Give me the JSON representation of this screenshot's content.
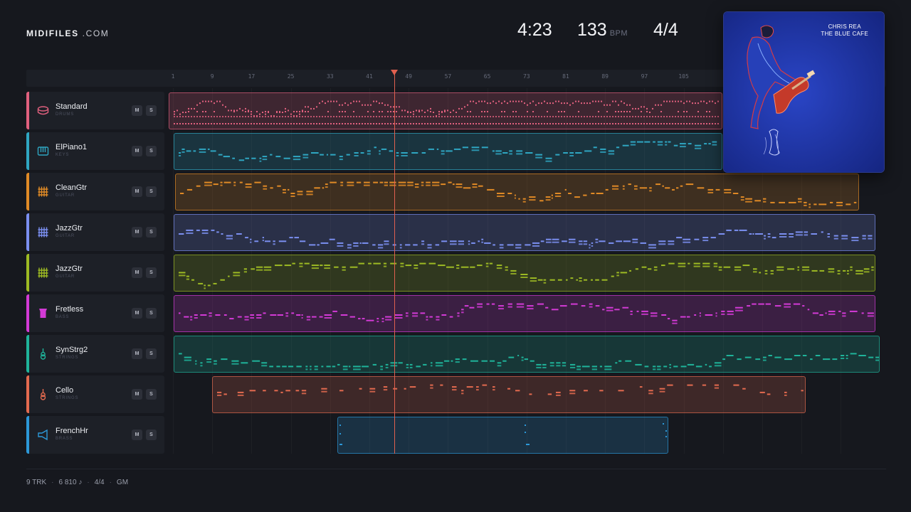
{
  "brand": {
    "bold": "MIDIFILES",
    "light": ".COM"
  },
  "stats": {
    "duration": "4:23",
    "tempo": "133",
    "tempo_unit": "BPM",
    "time_signature": "4/4"
  },
  "ruler": {
    "bars": [
      "1",
      "9",
      "17",
      "25",
      "33",
      "41",
      "49",
      "57",
      "65",
      "73",
      "81",
      "89",
      "97",
      "105"
    ]
  },
  "playhead": {
    "bar": 46
  },
  "album": {
    "line1": "CHRIS REA",
    "line2": "THE BLUE CAFE"
  },
  "tracks": [
    {
      "name": "Standard",
      "category": "DRUMS",
      "icon": "drum-icon",
      "color": "#e0607e",
      "mute": "M",
      "solo": "S"
    },
    {
      "name": "ElPiano1",
      "category": "KEYS",
      "icon": "piano-icon",
      "color": "#2fa6c2",
      "mute": "M",
      "solo": "S"
    },
    {
      "name": "CleanGtr",
      "category": "GUITAR",
      "icon": "guitar-grid-icon",
      "color": "#e08a26",
      "mute": "M",
      "solo": "S"
    },
    {
      "name": "JazzGtr",
      "category": "GUITAR",
      "icon": "guitar-grid-icon",
      "color": "#7b8ff0",
      "mute": "M",
      "solo": "S"
    },
    {
      "name": "JazzGtr",
      "category": "GUITAR",
      "icon": "guitar-grid-icon",
      "color": "#9dba23",
      "mute": "M",
      "solo": "S"
    },
    {
      "name": "Fretless",
      "category": "BASS",
      "icon": "bass-icon",
      "color": "#d33ad6",
      "mute": "M",
      "solo": "S"
    },
    {
      "name": "SynStrg2",
      "category": "STRINGS",
      "icon": "violin-icon",
      "color": "#1fb39a",
      "mute": "M",
      "solo": "S"
    },
    {
      "name": "Cello",
      "category": "STRINGS",
      "icon": "violin-icon",
      "color": "#e36a4f",
      "mute": "M",
      "solo": "S"
    },
    {
      "name": "FrenchHr",
      "category": "BRASS",
      "icon": "horn-icon",
      "color": "#2c98d8",
      "mute": "M",
      "solo": "S"
    }
  ],
  "footer": {
    "tracks": "9 TRK",
    "notes": "6 810 ♪",
    "time_signature": "4/4",
    "standard": "GM"
  }
}
